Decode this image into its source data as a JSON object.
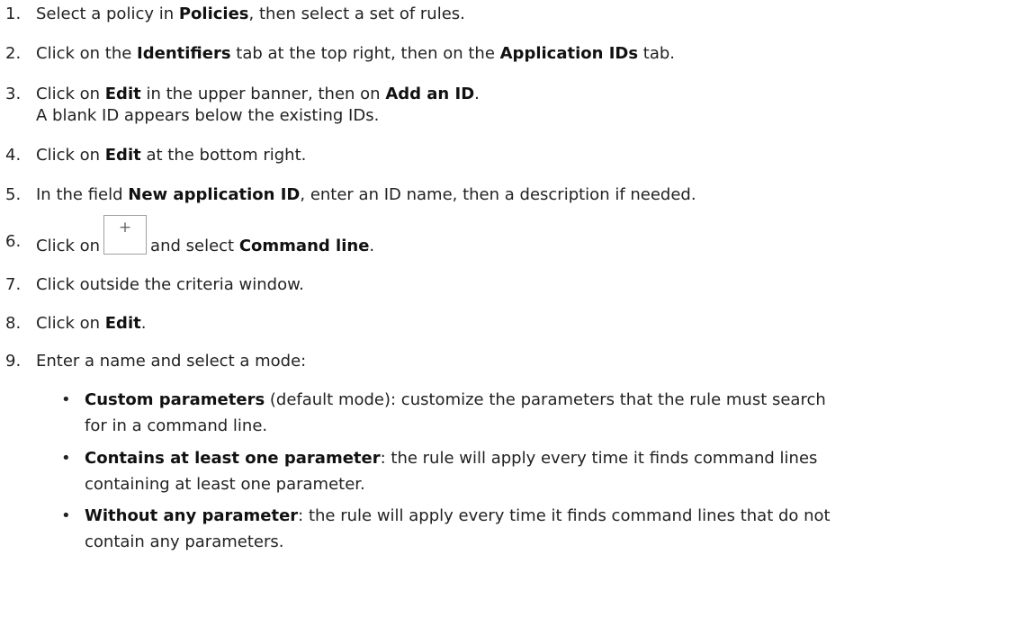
{
  "steps": [
    {
      "num": "1.",
      "parts": [
        {
          "t": "Select a policy in "
        },
        {
          "t": "Policies",
          "b": true
        },
        {
          "t": ", then select a set of rules."
        }
      ]
    },
    {
      "num": "2.",
      "parts": [
        {
          "t": "Click on the "
        },
        {
          "t": "Identifiers",
          "b": true
        },
        {
          "t": " tab at the top right, then on the "
        },
        {
          "t": "Application IDs",
          "b": true
        },
        {
          "t": " tab."
        }
      ]
    },
    {
      "num": "3.",
      "parts": [
        {
          "t": "Click on "
        },
        {
          "t": "Edit",
          "b": true
        },
        {
          "t": " in the upper banner, then on "
        },
        {
          "t": "Add an ID",
          "b": true
        },
        {
          "t": "."
        }
      ],
      "subline": "A blank ID appears below the existing IDs."
    },
    {
      "num": "4.",
      "parts": [
        {
          "t": "Click on "
        },
        {
          "t": "Edit",
          "b": true
        },
        {
          "t": " at the bottom right."
        }
      ]
    },
    {
      "num": "5.",
      "parts": [
        {
          "t": "In the field "
        },
        {
          "t": "New application ID",
          "b": true
        },
        {
          "t": ", enter an ID name, then a description if needed."
        }
      ]
    },
    {
      "num": "6.",
      "parts": [
        {
          "t": "Click on"
        },
        {
          "button": "+"
        },
        {
          "t": "and select "
        },
        {
          "t": "Command line",
          "b": true
        },
        {
          "t": "."
        }
      ]
    },
    {
      "num": "7.",
      "parts": [
        {
          "t": "Click outside the criteria window."
        }
      ]
    },
    {
      "num": "8.",
      "parts": [
        {
          "t": "Click on "
        },
        {
          "t": "Edit",
          "b": true
        },
        {
          "t": "."
        }
      ]
    },
    {
      "num": "9.",
      "parts": [
        {
          "t": "Enter a name and select a mode:"
        }
      ]
    }
  ],
  "modes": [
    {
      "bullet": "•",
      "label": "Custom parameters",
      "lines": [
        " (default mode): customize the parameters that the rule must search",
        "for in a command line."
      ]
    },
    {
      "bullet": "•",
      "label": "Contains at least one parameter",
      "lines": [
        ": the rule will apply every time it finds command lines",
        "containing at least one parameter."
      ]
    },
    {
      "bullet": "•",
      "label": "Without any parameter",
      "lines": [
        ": the rule will apply every time it finds command lines that do not",
        "contain any parameters."
      ]
    }
  ]
}
